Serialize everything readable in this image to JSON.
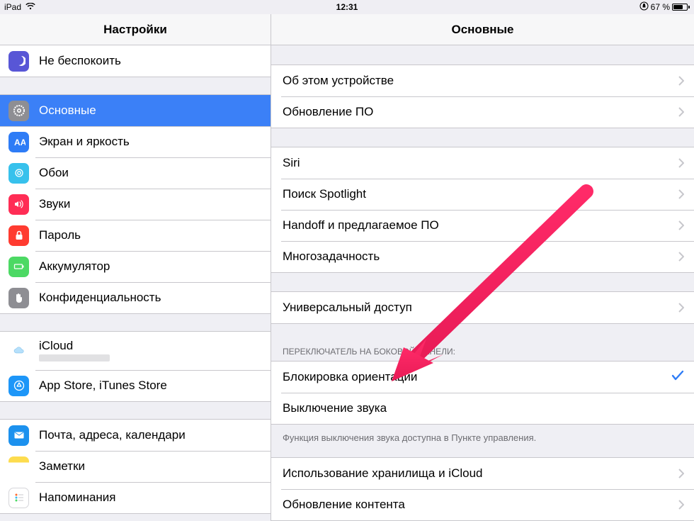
{
  "status": {
    "device": "iPad",
    "time": "12:31",
    "battery_pct": "67 %"
  },
  "sidebar": {
    "title": "Настройки",
    "dnd": "Не беспокоить",
    "general": "Основные",
    "display": "Экран и яркость",
    "wallpaper": "Обои",
    "sounds": "Звуки",
    "passcode": "Пароль",
    "battery": "Аккумулятор",
    "privacy": "Конфиденциальность",
    "icloud": "iCloud",
    "appstore": "App Store, iTunes Store",
    "mail": "Почта, адреса, календари",
    "notes": "Заметки",
    "reminders": "Напоминания"
  },
  "detail": {
    "title": "Основные",
    "about": "Об этом устройстве",
    "software_update": "Обновление ПО",
    "siri": "Siri",
    "spotlight": "Поиск Spotlight",
    "handoff": "Handoff и предлагаемое ПО",
    "multitasking": "Многозадачность",
    "accessibility": "Универсальный доступ",
    "side_switch_header": "ПЕРЕКЛЮЧАТЕЛЬ НА БОКОВОЙ ПАНЕЛИ:",
    "lock_rotation": "Блокировка ориентации",
    "mute": "Выключение звука",
    "side_switch_footer": "Функция выключения звука доступна в Пункте управления.",
    "storage": "Использование хранилища и iCloud",
    "background_refresh": "Обновление контента"
  }
}
